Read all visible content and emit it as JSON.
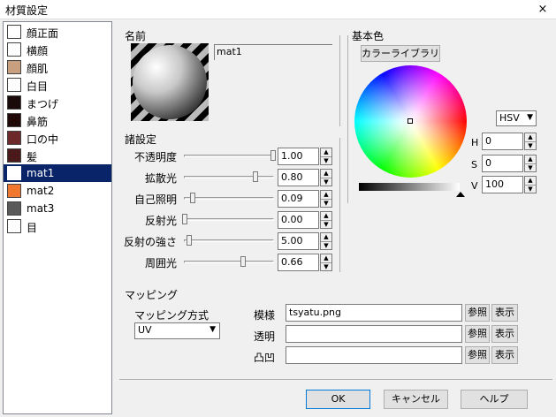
{
  "window": {
    "title": "材質設定",
    "close_symbol": "×"
  },
  "materials": [
    {
      "label": "顔正面",
      "color": "#ffffff"
    },
    {
      "label": "横顔",
      "color": "#ffffff"
    },
    {
      "label": "顔肌",
      "color": "#c8a080"
    },
    {
      "label": "白目",
      "color": "#ffffff"
    },
    {
      "label": "まつげ",
      "color": "#1a0a0a"
    },
    {
      "label": "鼻筋",
      "color": "#200808"
    },
    {
      "label": "口の中",
      "color": "#6e2a2a"
    },
    {
      "label": "髪",
      "color": "#4a1a1a"
    },
    {
      "label": "mat1",
      "color": "#ffffff",
      "selected": true
    },
    {
      "label": "mat2",
      "color": "#f07830"
    },
    {
      "label": "mat3",
      "color": "#5a5a5a"
    },
    {
      "label": "目",
      "color": "#ffffff"
    }
  ],
  "name_section": {
    "label": "名前",
    "value": "mat1"
  },
  "settings": {
    "label": "諸設定",
    "props": [
      {
        "label": "不透明度",
        "value": "1.00",
        "level": 1.0
      },
      {
        "label": "拡散光",
        "value": "0.80",
        "level": 0.8
      },
      {
        "label": "自己照明",
        "value": "0.09",
        "level": 0.09
      },
      {
        "label": "反射光",
        "value": "0.00",
        "level": 0.0
      },
      {
        "label": "反射の強さ",
        "value": "5.00",
        "level": 0.05
      },
      {
        "label": "周囲光",
        "value": "0.66",
        "level": 0.66
      }
    ]
  },
  "base_color": {
    "label": "基本色",
    "library_button": "カラーライブラリ",
    "mode": "HSV",
    "h_label": "H",
    "h_value": "0",
    "s_label": "S",
    "s_value": "0",
    "v_label": "V",
    "v_value": "100"
  },
  "mapping": {
    "label": "マッピング",
    "method_label": "マッピング方式",
    "method_value": "UV",
    "rows": [
      {
        "label": "模様",
        "value": "tsyatu.png"
      },
      {
        "label": "透明",
        "value": ""
      },
      {
        "label": "凸凹",
        "value": ""
      }
    ],
    "browse_label": "参照",
    "show_label": "表示"
  },
  "buttons": {
    "ok": "OK",
    "cancel": "キャンセル",
    "help": "ヘルプ"
  }
}
